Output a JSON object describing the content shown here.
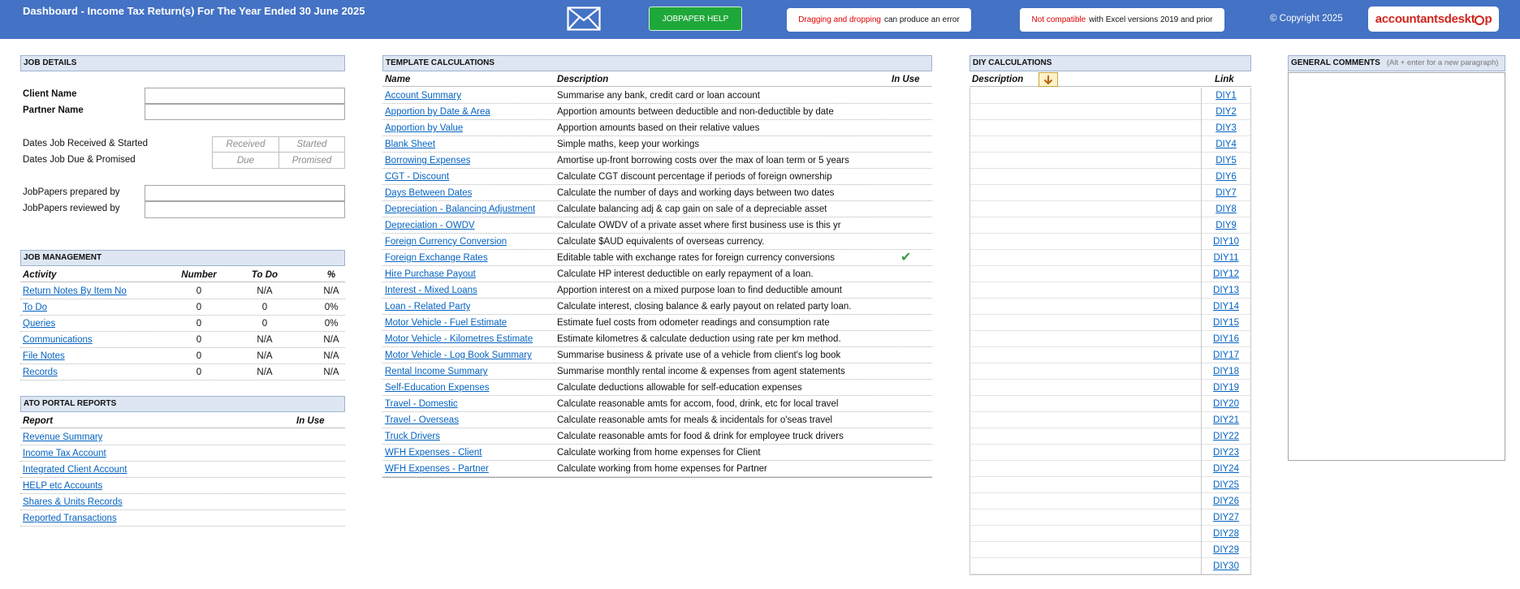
{
  "banner": {
    "title": "Dashboard - Income Tax Return(s) For The Year Ended 30 June 2025",
    "envelope_icon": "envelope-icon",
    "help_label": "JOBPAPER HELP",
    "warn_drag_red": "Dragging and dropping",
    "warn_drag_rest": "can produce an error",
    "warn_compat_red": "Not compatible",
    "warn_compat_rest": "with Excel versions 2019 and prior",
    "copyright": "© Copyright 2025",
    "brand_a": "accountantsdeskt",
    "brand_b": "p",
    "colors": {
      "banner": "#4472c4",
      "help": "#1fa83a",
      "warning": "#e00000",
      "link": "#0563c1",
      "brand": "#d0251f"
    }
  },
  "job_details": {
    "heading": "JOB DETAILS",
    "client_name_label": "Client Name",
    "partner_name_label": "Partner Name",
    "dates_received_label": "Dates Job Received & Started",
    "dates_due_label": "Dates Job Due & Promised",
    "received_ph": "Received",
    "started_ph": "Started",
    "due_ph": "Due",
    "promised_ph": "Promised",
    "prepared_by_label": "JobPapers prepared by",
    "reviewed_by_label": "JobPapers reviewed by"
  },
  "job_management": {
    "heading": "JOB MANAGEMENT",
    "columns": [
      "Activity",
      "Number",
      "To Do",
      "%"
    ],
    "rows": [
      {
        "activity": "Return Notes By Item No",
        "number": "0",
        "todo": "N/A",
        "pct": "N/A"
      },
      {
        "activity": "To Do",
        "number": "0",
        "todo": "0",
        "pct": "0%"
      },
      {
        "activity": "Queries",
        "number": "0",
        "todo": "0",
        "pct": "0%"
      },
      {
        "activity": "Communications",
        "number": "0",
        "todo": "N/A",
        "pct": "N/A"
      },
      {
        "activity": "File Notes",
        "number": "0",
        "todo": "N/A",
        "pct": "N/A"
      },
      {
        "activity": "Records ",
        "number": "0",
        "todo": "N/A",
        "pct": "N/A"
      }
    ]
  },
  "ato_portal": {
    "heading": "ATO PORTAL REPORTS",
    "columns": [
      "Report",
      "In Use"
    ],
    "rows": [
      "Revenue Summary",
      "Income Tax Account",
      "Integrated Client Account",
      "HELP etc Accounts",
      "Shares & Units Records",
      "Reported Transactions"
    ]
  },
  "template_calcs": {
    "heading": "TEMPLATE CALCULATIONS",
    "columns": [
      "Name",
      "Description",
      "In Use"
    ],
    "check_icon": "check-icon",
    "rows": [
      {
        "name": "Account Summary",
        "desc": "Summarise any bank, credit card or loan account",
        "in_use": false
      },
      {
        "name": "Apportion by Date & Area",
        "desc": "Apportion amounts between deductible and non-deductible by date",
        "in_use": false
      },
      {
        "name": "Apportion by Value",
        "desc": "Apportion amounts based on their relative values",
        "in_use": false
      },
      {
        "name": "Blank Sheet",
        "desc": "Simple maths, keep your workings",
        "in_use": false
      },
      {
        "name": "Borrowing Expenses",
        "desc": "Amortise up-front borrowing costs over the max of loan term or 5 years",
        "in_use": false
      },
      {
        "name": "CGT - Discount",
        "desc": "Calculate CGT discount percentage if periods of foreign ownership",
        "in_use": false
      },
      {
        "name": "Days Between Dates",
        "desc": "Calculate the number of days and working days between two dates",
        "in_use": false
      },
      {
        "name": "Depreciation - Balancing Adjustment",
        "desc": "Calculate balancing adj & cap gain on sale of a depreciable asset",
        "in_use": false
      },
      {
        "name": "Depreciation - OWDV",
        "desc": "Calculate OWDV of a private asset where first business use is this yr",
        "in_use": false
      },
      {
        "name": "Foreign Currency Conversion",
        "desc": "Calculate $AUD equivalents of overseas currency.",
        "in_use": false
      },
      {
        "name": "Foreign Exchange Rates",
        "desc": "Editable table with exchange rates for foreign currency conversions",
        "in_use": true
      },
      {
        "name": "Hire Purchase Payout",
        "desc": "Calculate HP interest deductible on early repayment of a loan.",
        "in_use": false
      },
      {
        "name": "Interest - Mixed Loans",
        "desc": "Apportion interest on a mixed purpose loan to find deductible amount",
        "in_use": false
      },
      {
        "name": "Loan - Related Party",
        "desc": "Calculate interest, closing balance & early payout on related party loan.",
        "in_use": false
      },
      {
        "name": "Motor Vehicle - Fuel Estimate",
        "desc": "Estimate fuel costs from odometer readings and consumption rate",
        "in_use": false
      },
      {
        "name": "Motor Vehicle - Kilometres Estimate",
        "desc": "Estimate kilometres & calculate deduction using rate per km method.",
        "in_use": false
      },
      {
        "name": "Motor Vehicle - Log Book Summary",
        "desc": "Summarise business & private use of a vehicle from client's log book",
        "in_use": false
      },
      {
        "name": "Rental Income Summary",
        "desc": "Summarise monthly rental income & expenses from agent statements",
        "in_use": false
      },
      {
        "name": "Self-Education Expenses",
        "desc": "Calculate deductions allowable for self-education expenses",
        "in_use": false
      },
      {
        "name": "Travel - Domestic",
        "desc": "Calculate reasonable amts for accom, food, drink, etc for local travel",
        "in_use": false
      },
      {
        "name": "Travel - Overseas",
        "desc": "Calculate reasonable amts for meals & incidentals for o'seas travel",
        "in_use": false
      },
      {
        "name": "Truck Drivers",
        "desc": "Calculate reasonable amts for food & drink for employee truck drivers",
        "in_use": false
      },
      {
        "name": "WFH Expenses - Client",
        "desc": "Calculate working from home expenses for Client",
        "in_use": false
      },
      {
        "name": "WFH Expenses - Partner",
        "desc": "Calculate working from home expenses for Partner",
        "in_use": false
      }
    ]
  },
  "diy": {
    "heading": "DIY CALCULATIONS",
    "columns": [
      "Description",
      "Link"
    ],
    "sort_icon": "arrow-down-icon",
    "links": [
      "DIY1",
      "DIY2",
      "DIY3",
      "DIY4",
      "DIY5",
      "DIY6",
      "DIY7",
      "DIY8",
      "DIY9",
      "DIY10",
      "DIY11",
      "DIY12",
      "DIY13",
      "DIY14",
      "DIY15",
      "DIY16",
      "DIY17",
      "DIY18",
      "DIY19",
      "DIY20",
      "DIY21",
      "DIY22",
      "DIY23",
      "DIY24",
      "DIY25",
      "DIY26",
      "DIY27",
      "DIY28",
      "DIY29",
      "DIY30"
    ]
  },
  "comments": {
    "heading": "GENERAL COMMENTS",
    "hint": "(Alt + enter for a new paragraph)"
  }
}
